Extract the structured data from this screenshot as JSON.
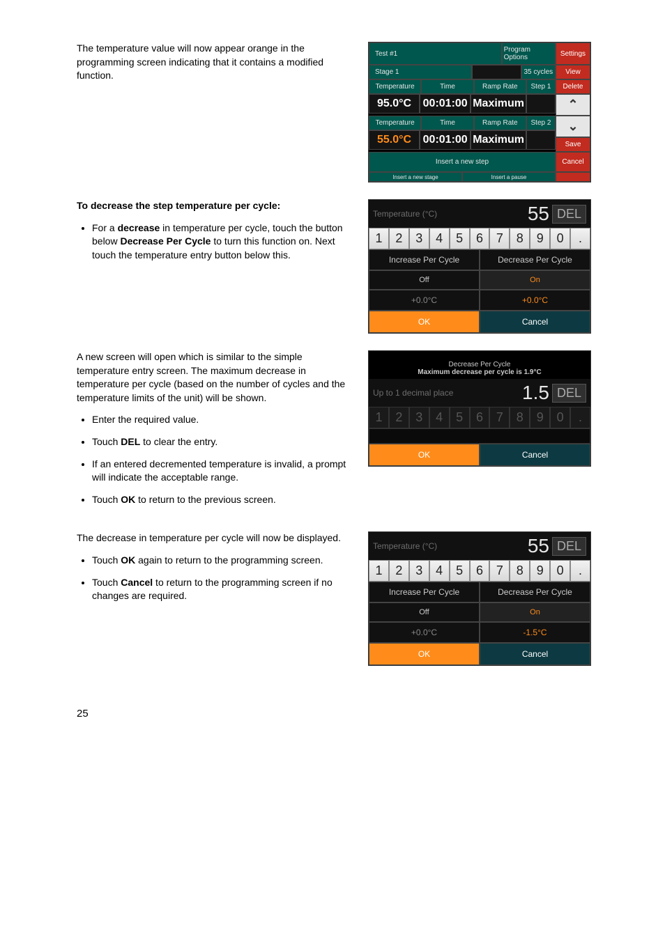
{
  "section1": {
    "para": "The temperature value will now appear orange in the programming screen indicating that it contains a modified function."
  },
  "prog": {
    "testLabel": "Test #1",
    "programOptions": "Program Options",
    "settings": "Settings",
    "stageLabel": "Stage 1",
    "cycles": "35 cycles",
    "view": "View",
    "delete": "Delete",
    "save": "Save",
    "cancel": "Cancel",
    "col": {
      "temp": "Temperature",
      "time": "Time",
      "ramp": "Ramp Rate"
    },
    "step1": {
      "tag": "Step 1",
      "temp": "95.0°C",
      "time": "00:01:00",
      "ramp": "Maximum"
    },
    "step2": {
      "tag": "Step 2",
      "temp": "55.0°C",
      "time": "00:01:00",
      "ramp": "Maximum"
    },
    "insertStep": "Insert a new step",
    "insertStage": "Insert a new stage",
    "insertPause": "Insert a pause"
  },
  "section2": {
    "heading": "To decrease the step temperature per cycle:",
    "bullet": {
      "pre": "For a ",
      "b1": "decrease",
      "mid": " in temperature per cycle, touch the button below ",
      "b2": "Decrease Per Cycle",
      "post": " to turn this function on. Next touch the temperature entry button below this."
    }
  },
  "kp1": {
    "label": "Temperature (°C)",
    "value": "55",
    "del": "DEL",
    "keys": [
      "1",
      "2",
      "3",
      "4",
      "5",
      "6",
      "7",
      "8",
      "9",
      "0",
      "."
    ],
    "inc": "Increase Per Cycle",
    "dec": "Decrease Per Cycle",
    "off": "Off",
    "on": "On",
    "incVal": "+0.0°C",
    "decVal": "+0.0°C",
    "ok": "OK",
    "cancel": "Cancel"
  },
  "section3": {
    "para": "A new screen will open which is similar to the simple temperature entry screen. The maximum decrease in temperature per cycle (based on the number of cycles and the temperature limits of the unit) will be shown.",
    "b1": "Enter the required value.",
    "b2": {
      "pre": "Touch ",
      "b": "DEL",
      "post": " to clear the entry."
    },
    "b3": "If an entered decremented temperature is invalid, a prompt will indicate the acceptable range.",
    "b4": {
      "pre": "Touch ",
      "b": "OK",
      "post": " to return to the previous screen."
    }
  },
  "kp2": {
    "hdr1": "Decrease Per Cycle",
    "hdr2": "Maximum decrease per cycle is 1.9°C",
    "label": "Up to 1 decimal place",
    "value": "1.5",
    "del": "DEL",
    "keys": [
      "1",
      "2",
      "3",
      "4",
      "5",
      "6",
      "7",
      "8",
      "9",
      "0",
      "."
    ],
    "ok": "OK",
    "cancel": "Cancel"
  },
  "section4": {
    "para": "The decrease in temperature per cycle will now be displayed.",
    "b1": {
      "pre": "Touch ",
      "b": "OK",
      "post": " again to return to the programming screen."
    },
    "b2": {
      "pre": "Touch ",
      "b": "Cancel",
      "post": " to return to the programming screen if no changes are required."
    }
  },
  "kp3": {
    "label": "Temperature (°C)",
    "value": "55",
    "del": "DEL",
    "keys": [
      "1",
      "2",
      "3",
      "4",
      "5",
      "6",
      "7",
      "8",
      "9",
      "0",
      "."
    ],
    "inc": "Increase Per Cycle",
    "dec": "Decrease Per Cycle",
    "off": "Off",
    "on": "On",
    "incVal": "+0.0°C",
    "decVal": "-1.5°C",
    "ok": "OK",
    "cancel": "Cancel"
  },
  "pageNumber": "25"
}
